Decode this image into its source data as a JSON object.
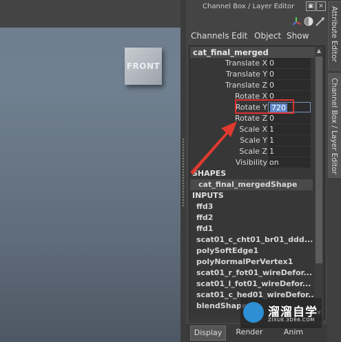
{
  "viewport": {
    "label": "FRONT"
  },
  "panel": {
    "title": "Channel Box / Layer Editor",
    "menus": [
      "Channels",
      "Edit",
      "Object",
      "Show"
    ],
    "object_name": "cat_final_merged",
    "attributes": [
      {
        "label": "Translate X",
        "value": "0"
      },
      {
        "label": "Translate Y",
        "value": "0"
      },
      {
        "label": "Translate Z",
        "value": "0"
      },
      {
        "label": "Rotate X",
        "value": "0"
      },
      {
        "label": "Rotate Y",
        "value": "720"
      },
      {
        "label": "Rotate Z",
        "value": "0"
      },
      {
        "label": "Scale X",
        "value": "1"
      },
      {
        "label": "Scale Y",
        "value": "1"
      },
      {
        "label": "Scale Z",
        "value": "1"
      },
      {
        "label": "Visibility",
        "value": "on"
      }
    ],
    "shapes_header": "SHAPES",
    "shape_name": "cat_final_mergedShape",
    "inputs_header": "INPUTS",
    "inputs": [
      "ffd3",
      "ffd2",
      "ffd1",
      "scat01_c_cht01_br01_ddd...",
      "polySoftEdge1",
      "polyNormalPerVertex1",
      "scat01_r_fot01_wireDefor...",
      "scat01_l_fot01_wireDefor...",
      "scat01_c_hed01_wireDefor...",
      "blendShape..."
    ],
    "bottom_tabs": [
      "Display",
      "Render",
      "Anim"
    ]
  },
  "side_tabs": [
    "Attribute Editor",
    "Channel Box / Layer Editor"
  ],
  "watermark": {
    "title": "溜溜自学",
    "subtitle": "ZIXUE.3D66.COM"
  },
  "colors": {
    "highlight": "#e03030",
    "selection": "#5f87c7",
    "arrow": "#e03a2e"
  }
}
